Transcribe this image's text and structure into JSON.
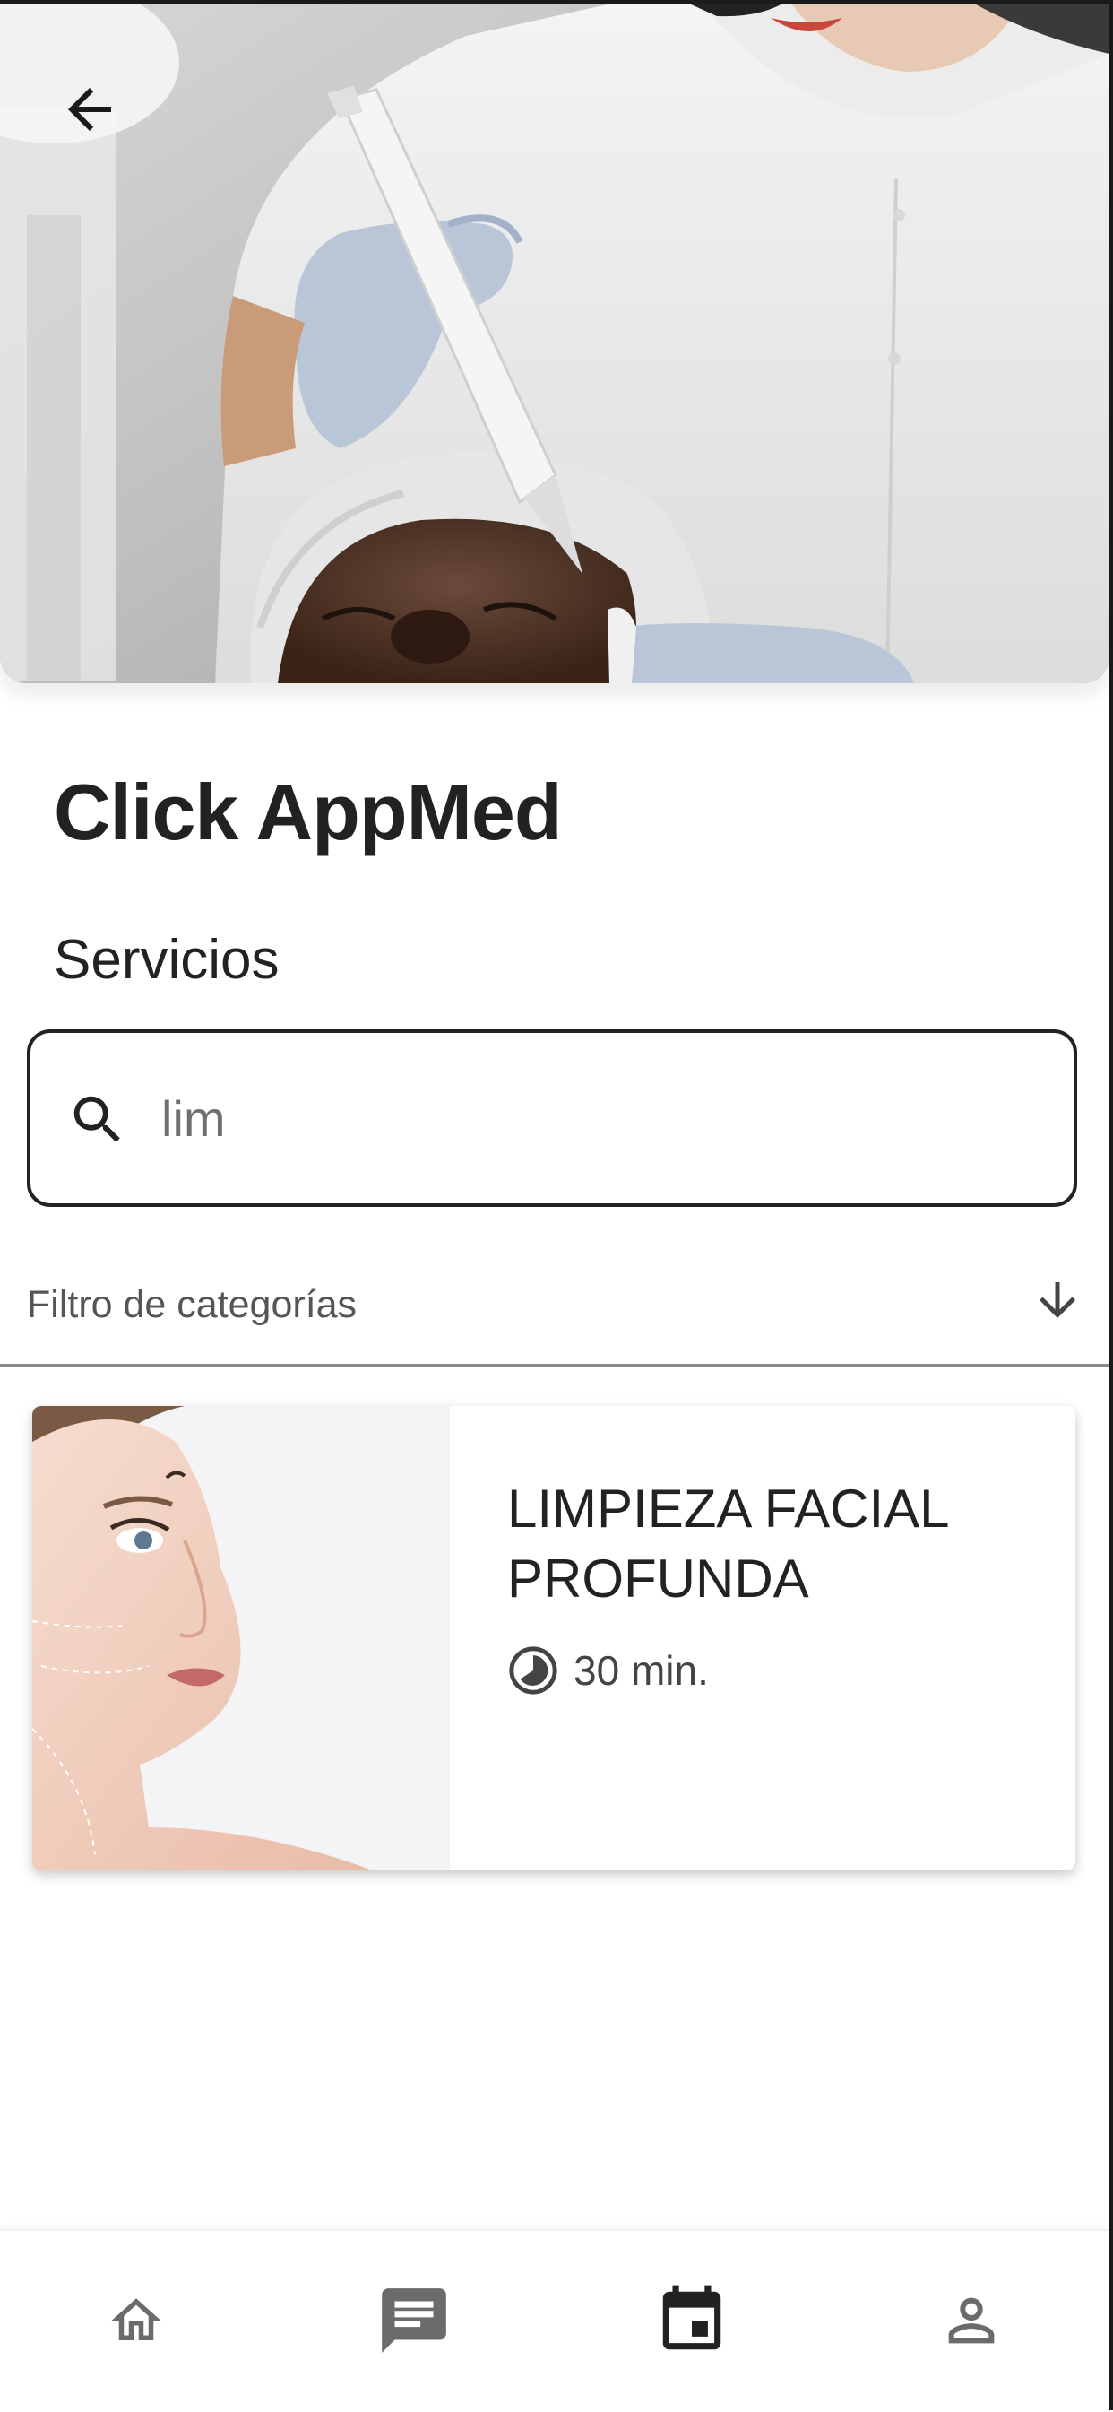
{
  "header": {
    "back_icon": "arrow-left-icon",
    "hero_image": "facial-treatment-photo"
  },
  "app": {
    "title": "Click AppMed"
  },
  "services": {
    "section_title": "Servicios",
    "search": {
      "icon": "search-icon",
      "value": "lim",
      "placeholder": ""
    },
    "filter": {
      "label": "Filtro de categorías",
      "icon": "arrow-down-icon"
    },
    "items": [
      {
        "title": "LIMPIEZA FACIAL PROFUNDA",
        "duration": "30 min.",
        "duration_icon": "clock-icon",
        "image": "woman-face-portrait"
      }
    ]
  },
  "bottom_nav": {
    "items": [
      {
        "icon": "home-icon",
        "active": false
      },
      {
        "icon": "chat-icon",
        "active": false
      },
      {
        "icon": "calendar-icon",
        "active": true
      },
      {
        "icon": "profile-icon",
        "active": false
      }
    ]
  },
  "colors": {
    "text_primary": "#222222",
    "text_secondary": "#555555",
    "nav_inactive": "#6b6b6b",
    "nav_active": "#222222",
    "border": "#222222"
  }
}
